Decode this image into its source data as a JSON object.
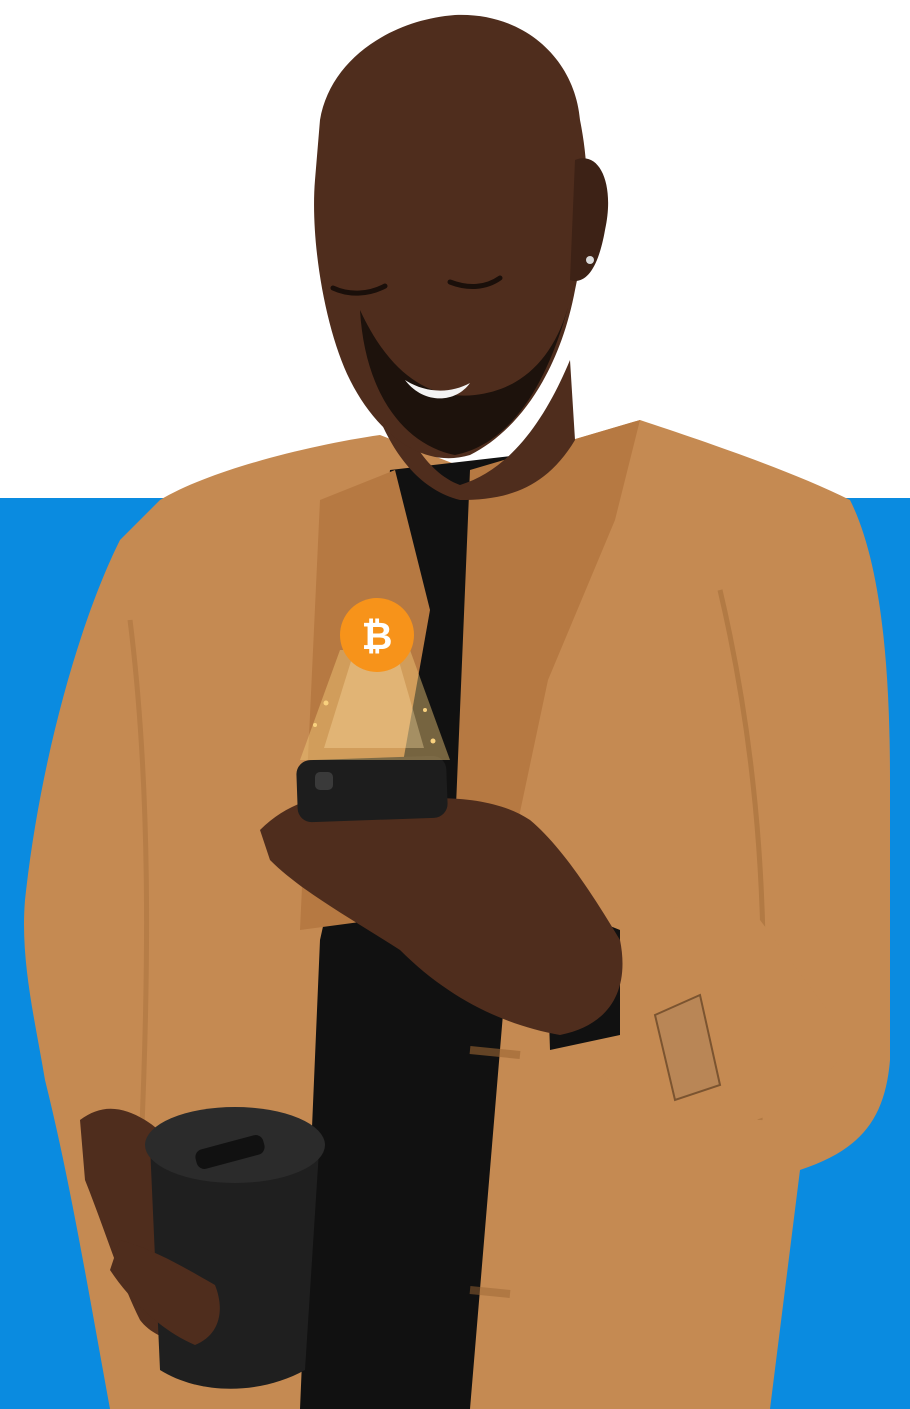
{
  "palette": {
    "background": "#ffffff",
    "panel_blue": "#0a8be0",
    "coat": "#c58a52",
    "coat_shadow": "#9b6534",
    "coat_highlight": "#d69f68",
    "skin": "#4f2d1d",
    "skin_shadow": "#2f1b11",
    "shirt": "#111111",
    "phone": "#1d1d1d",
    "cup": "#1f1f1f",
    "coin": "#f7931a",
    "coin_symbol": "#ffffff",
    "beam": "#f2c979",
    "sparkle": "#ffd782"
  },
  "icons": {
    "coin": "bitcoin-icon",
    "beam": "sparkle-beam"
  }
}
